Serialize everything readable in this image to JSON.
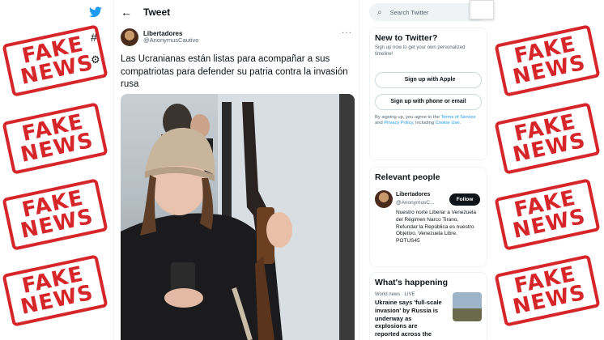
{
  "stamps": {
    "line1": "FAKE",
    "line2": "NEWS"
  },
  "nav": {
    "logo_icon": "twitter-bird-icon",
    "explore_icon": "hashtag-icon",
    "settings_icon": "gear-icon"
  },
  "tweet": {
    "header_title": "Tweet",
    "author_name": "Libertadores",
    "author_handle": "@AnonymusCautivo",
    "text": "Las Ucranianas están listas para acompañar a sus compatriotas para defender su patria contra la invasión rusa",
    "more_label": "···",
    "image_icon": "photo-of-young-woman-with-rifle-on-bus"
  },
  "search": {
    "placeholder": "Search Twitter"
  },
  "new_to_twitter": {
    "title": "New to Twitter?",
    "subtitle": "Sign up now to get your own personalized timeline!",
    "apple_button": "Sign up with Apple",
    "phone_button": "Sign up with phone or email",
    "terms_prefix": "By signing up, you agree to the ",
    "terms_link": "Terms of Service",
    "terms_middle": " and ",
    "privacy_link": "Privacy Policy",
    "terms_middle2": ", including ",
    "cookie_link": "Cookie Use",
    "terms_suffix": "."
  },
  "relevant_people": {
    "title": "Relevant people",
    "name": "Libertadores",
    "handle": "@AnonymusC...",
    "follow_label": "Follow",
    "bio": "Nuestro norte Liberar a Venezuela del Régimen Narco Tirano, Refundar la República es nuestro Objetivo. Venezuela Libre. POTUS45"
  },
  "whats_happening": {
    "title": "What's happening",
    "meta": "World news · LIVE",
    "headline": "Ukraine says 'full-scale invasion' by Russia is underway as explosions are reported across the"
  },
  "colors": {
    "stamp_red": "#d6262a",
    "twitter_blue": "#1d9bf0",
    "text_primary": "#0f1419",
    "text_secondary": "#536471"
  }
}
